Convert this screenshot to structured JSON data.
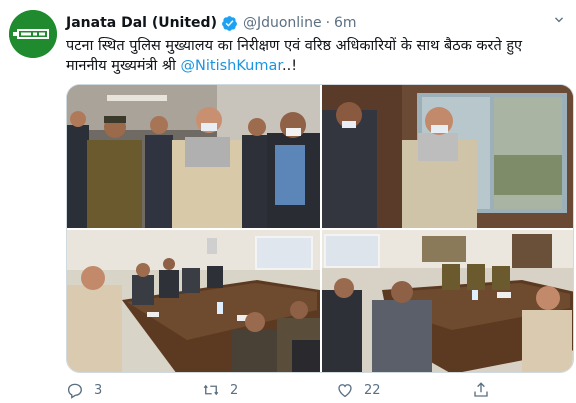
{
  "author": {
    "name": "Janata Dal (United)",
    "handle": "@Jduonline",
    "separator": "·",
    "time": "6m"
  },
  "tweet": {
    "line1": "पटना स्थित पुलिस मुख्यालय का निरीक्षण एवं वरिष्ठ अधिकारियों के साथ बैठक करते हुए",
    "line2_prefix": "माननीय मुख्यमंत्री श्री ",
    "mention": "@NitishKumar",
    "line2_suffix": "..!"
  },
  "actions": {
    "reply_count": "3",
    "retweet_count": "2",
    "like_count": "22"
  },
  "icons": {
    "verified": "verified-badge-icon",
    "caret": "chevron-down-icon",
    "reply": "reply-icon",
    "retweet": "retweet-icon",
    "like": "heart-icon",
    "share": "share-icon"
  },
  "colors": {
    "accent": "#1b95e0",
    "muted": "#5b7083",
    "avatar_bg": "#1f8b2e"
  }
}
